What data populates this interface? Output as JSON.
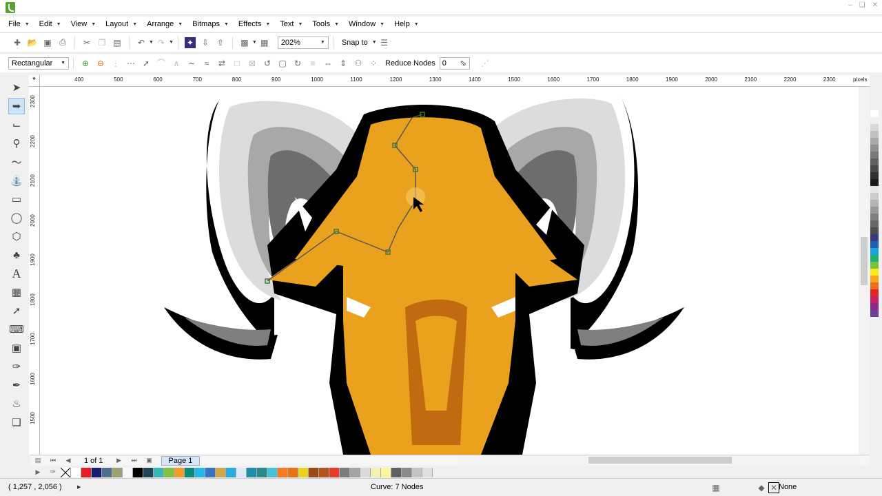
{
  "menu": [
    "File",
    "Edit",
    "View",
    "Layout",
    "Arrange",
    "Bitmaps",
    "Effects",
    "Text",
    "Tools",
    "Window",
    "Help"
  ],
  "toolbar": {
    "zoom": "202%",
    "snap_to": "Snap to"
  },
  "property_bar": {
    "selection_mode": "Rectangular",
    "reduce_nodes_label": "Reduce Nodes",
    "reduce_nodes_value": "0"
  },
  "ruler": {
    "unit": "pixels",
    "h_ticks": [
      "400",
      "500",
      "600",
      "700",
      "800",
      "900",
      "1000",
      "1100",
      "1200",
      "1300",
      "1400",
      "1500",
      "1600",
      "1700",
      "1800",
      "1900",
      "2000",
      "2100",
      "2200",
      "2300"
    ],
    "v_ticks": [
      "2300",
      "2200",
      "2100",
      "2000",
      "1900",
      "1800",
      "1700",
      "1600",
      "1500"
    ]
  },
  "page_nav": {
    "page_count": "1 of 1",
    "page_tab": "Page 1"
  },
  "status": {
    "coordinates": "( 1,257 , 2,056 )",
    "object_info": "Curve: 7 Nodes",
    "fill": "None"
  },
  "colors": {
    "ram_orange": "#e9a11e",
    "ram_dark_orange": "#c16a10",
    "horn_light": "#dcdcdc",
    "horn_mid": "#a8a8a8",
    "horn_dark": "#6d6d6d",
    "outline": "#000000",
    "selection": "#1f6fd8"
  },
  "palette_row": [
    "#ffffff",
    "#e31e24",
    "#1a1a6e",
    "#4f6f8f",
    "#9aa36f",
    "#f6f6f6",
    "#000000",
    "#224455",
    "#34b7b5",
    "#7dc242",
    "#f39b28",
    "#0c8a7a",
    "#24b8e8",
    "#3674c4",
    "#d1a54a",
    "#26aae1",
    "#dcebf8",
    "#1f8ea8",
    "#2d8a8a",
    "#47c1d8",
    "#f47b20",
    "#e4731c",
    "#ebd21e",
    "#9c4a1a",
    "#b2541d",
    "#e63a2a",
    "#7c7c7c",
    "#a3a3a3",
    "#d9d9d9",
    "#f4f0b8",
    "#fff5a0",
    "#606060",
    "#8a8a8a",
    "#c4c4c4",
    "#e0e0e0"
  ],
  "palette_col": [
    "#ffffff",
    "#f0f0f0",
    "#d8d8d8",
    "#c0c0c0",
    "#a8a8a8",
    "#909090",
    "#787878",
    "#606060",
    "#484848",
    "#303030",
    "#181818",
    "#e6e6e6",
    "#cccccc",
    "#b3b3b3",
    "#999999",
    "#808080",
    "#666666",
    "#4d4d4d",
    "#3a3a7a",
    "#1e5fb0",
    "#1aa3e0",
    "#1db36c",
    "#79c043",
    "#f7ec1a",
    "#f9a51a",
    "#f06b22",
    "#e32726",
    "#c81f66",
    "#8a2a8b",
    "#6b3f98"
  ]
}
